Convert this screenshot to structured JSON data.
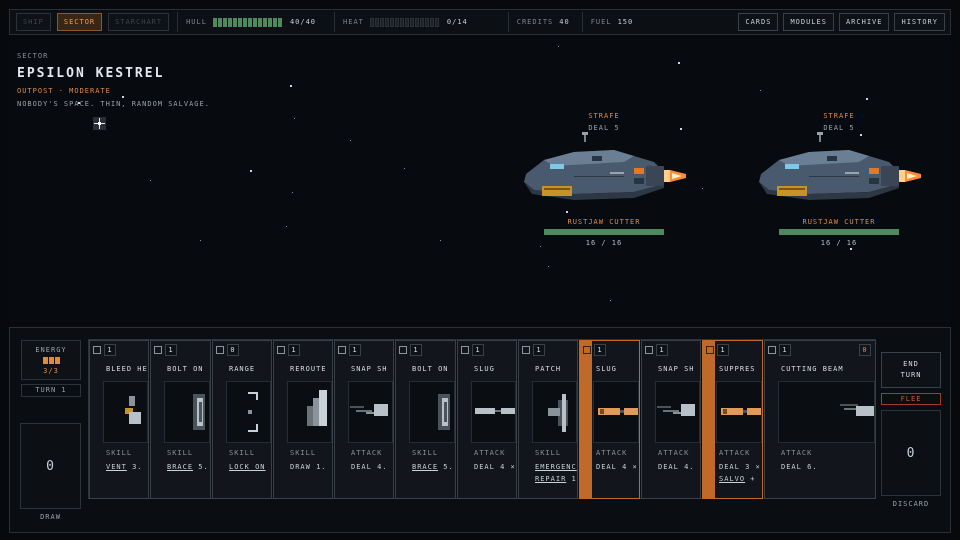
{
  "nav": {
    "tabs": [
      {
        "label": "SHIP",
        "active": false
      },
      {
        "label": "SECTOR",
        "active": true
      },
      {
        "label": "STARCHART",
        "active": false
      }
    ]
  },
  "status": {
    "hull_label": "HULL",
    "hull_value": "40/40",
    "hull_fraction": 1.0,
    "heat_label": "HEAT",
    "heat_value": "0/14",
    "heat_fraction": 0,
    "credits_label": "CREDITS",
    "credits_value": "40",
    "fuel_label": "FUEL",
    "fuel_value": "150"
  },
  "menu": [
    "CARDS",
    "MODULES",
    "ARCHIVE",
    "HISTORY"
  ],
  "sector": {
    "label": "SECTOR",
    "name": "EPSILON KESTREL",
    "type": "OUTPOST · MODERATE",
    "description": "NOBODY'S SPACE. THIN, RANDOM SALVAGE."
  },
  "enemies": [
    {
      "intent": "STRAFE",
      "intent_value": "DEAL 5",
      "name": "RUSTJAW CUTTER",
      "hp": "16 / 16",
      "hp_fraction": 1.0
    },
    {
      "intent": "STRAFE",
      "intent_value": "DEAL 5",
      "name": "RUSTJAW CUTTER",
      "hp": "16 / 16",
      "hp_fraction": 1.0
    }
  ],
  "energy": {
    "label": "ENERGY",
    "value": "3/3",
    "pips": 3
  },
  "turn": "TURN 1",
  "draw": {
    "count": "0",
    "label": "DRAW"
  },
  "discard": {
    "count": "0",
    "label": "DISCARD"
  },
  "end_turn": "END TURN",
  "flee": "FLEE",
  "colors": {
    "accent": "#e08a4a",
    "hull": "#4f8a5e",
    "flee": "#d05a3a"
  },
  "hand": [
    {
      "cost": "1",
      "name": "BLEED HE",
      "type": "SKILL",
      "desc": [
        {
          "u": "VENT"
        },
        {
          "t": " 3."
        }
      ],
      "art": "vent",
      "hl": false
    },
    {
      "cost": "1",
      "name": "BOLT ON",
      "type": "SKILL",
      "desc": [
        {
          "u": "BRACE"
        },
        {
          "t": " 5."
        }
      ],
      "art": "brace",
      "hl": false
    },
    {
      "cost": "0",
      "name": "RANGE",
      "type": "SKILL",
      "desc": [
        {
          "u": "LOCK ON"
        }
      ],
      "art": "lock",
      "hl": false
    },
    {
      "cost": "1",
      "name": "REROUTE",
      "type": "SKILL",
      "desc": [
        {
          "t": "DRAW 1."
        }
      ],
      "art": "reroute",
      "hl": false
    },
    {
      "cost": "1",
      "name": "SNAP SH",
      "type": "ATTACK",
      "desc": [
        {
          "t": "DEAL 4."
        }
      ],
      "art": "gun",
      "hl": false
    },
    {
      "cost": "1",
      "name": "BOLT ON",
      "type": "SKILL",
      "desc": [
        {
          "u": "BRACE"
        },
        {
          "t": " 5."
        }
      ],
      "art": "brace",
      "hl": false
    },
    {
      "cost": "1",
      "name": "SLUG",
      "type": "ATTACK",
      "desc": [
        {
          "t": "DEAL 4 ×"
        }
      ],
      "art": "slug",
      "hl": false
    },
    {
      "cost": "1",
      "name": "PATCH",
      "type": "SKILL",
      "desc": [
        {
          "u": "EMERGENC"
        },
        {
          "br": true
        },
        {
          "u": "REPAIR"
        },
        {
          "t": " 1."
        }
      ],
      "art": "patch",
      "hl": false
    },
    {
      "cost": "1",
      "name": "SLUG",
      "type": "ATTACK",
      "desc": [
        {
          "t": "DEAL 4 ×"
        }
      ],
      "art": "slug-hot",
      "hl": true
    },
    {
      "cost": "1",
      "name": "SNAP SH",
      "type": "ATTACK",
      "desc": [
        {
          "t": "DEAL 4."
        }
      ],
      "art": "gun",
      "hl": false
    },
    {
      "cost": "1",
      "name": "SUPPRES",
      "type": "ATTACK",
      "desc": [
        {
          "t": "DEAL 3 ×"
        },
        {
          "br": true
        },
        {
          "u": "SALVO"
        },
        {
          "t": " +"
        }
      ],
      "art": "slug-hot",
      "hl": true
    },
    {
      "cost": "1",
      "name": "CUTTING BEAM",
      "type": "ATTACK",
      "desc": [
        {
          "t": "DEAL 6."
        }
      ],
      "art": "beam",
      "hl": false,
      "cost_right": "0"
    }
  ]
}
